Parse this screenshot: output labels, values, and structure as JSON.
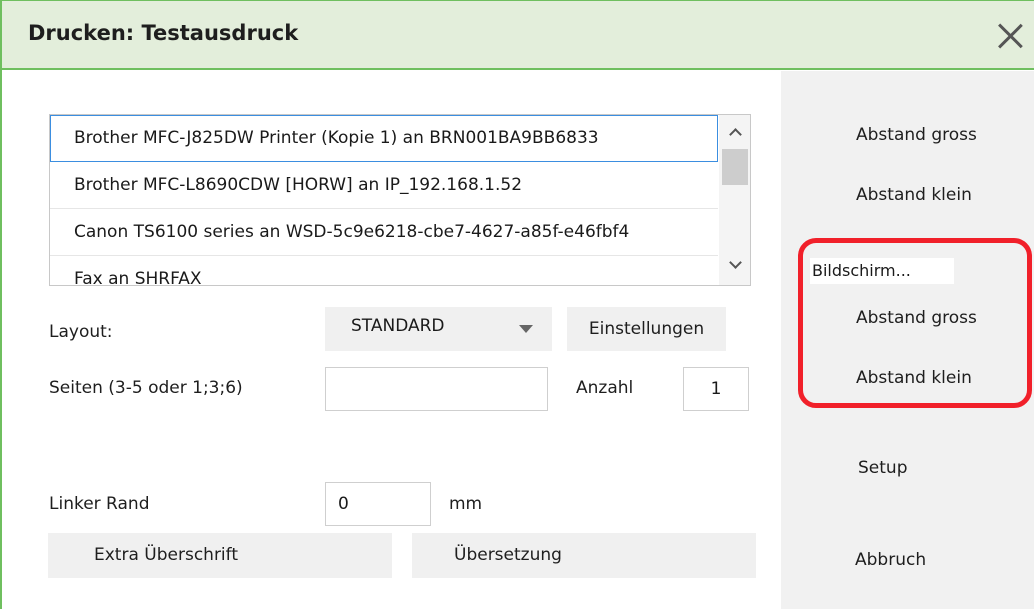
{
  "dialog": {
    "title": "Drucken: Testausdruck",
    "accent_color": "#6fbf5f",
    "titlebar_bg": "#e3eedb"
  },
  "close_icon": "close-x-icon",
  "printers": [
    "Brother MFC-J825DW Printer (Kopie 1) an BRN001BA9BB6833",
    "Brother MFC-L8690CDW [HORW] an IP_192.168.1.52",
    "Canon TS6100 series an WSD-5c9e6218-cbe7-4627-a85f-e46fbf4",
    "Fax an SHRFAX"
  ],
  "selected_printer_index": 0,
  "layout": {
    "label": "Layout:",
    "value": "STANDARD",
    "settings_button": "Einstellungen"
  },
  "pages": {
    "label": "Seiten (3-5 oder 1;3;6)",
    "value": "",
    "count_label": "Anzahl",
    "count_value": "1"
  },
  "margin": {
    "label": "Linker Rand",
    "value": "0",
    "unit": "mm"
  },
  "buttons": {
    "extra_heading": "Extra Überschrift",
    "translation": "Übersetzung"
  },
  "side": {
    "print_large": "Abstand gross",
    "print_small": "Abstand klein",
    "screen_group": "Bildschirm...",
    "screen_large": "Abstand gross",
    "screen_small": "Abstand klein",
    "setup": "Setup",
    "cancel": "Abbruch"
  },
  "highlight_color": "#f1202a"
}
